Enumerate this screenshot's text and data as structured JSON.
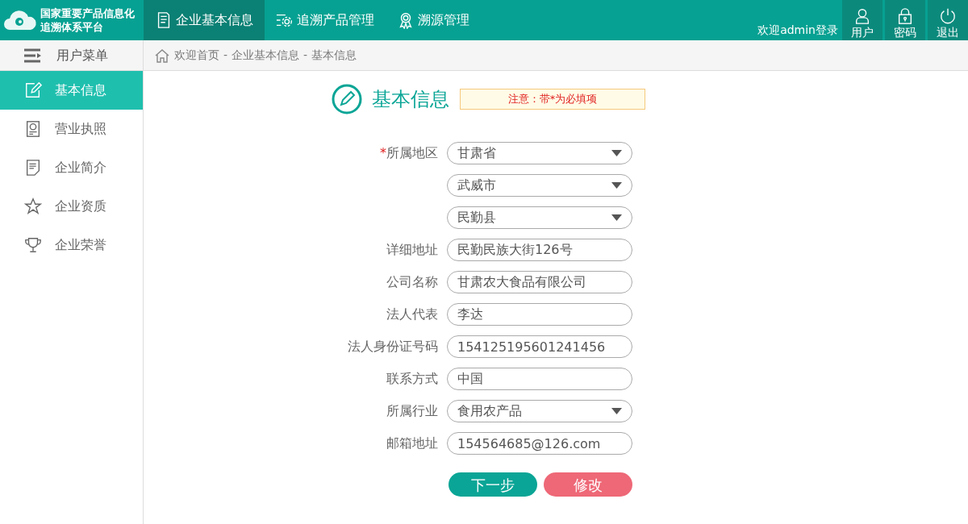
{
  "header": {
    "logo_text": [
      "国家重要产品信息化",
      "追溯体系平台"
    ],
    "nav": [
      {
        "label": "企业基本信息",
        "selected": true
      },
      {
        "label": "追溯产品管理",
        "selected": false
      },
      {
        "label": "溯源管理",
        "selected": false
      }
    ],
    "welcome": "欢迎admin登录",
    "actions": [
      {
        "label": "用户"
      },
      {
        "label": "密码"
      },
      {
        "label": "退出"
      }
    ]
  },
  "sidebar": {
    "title": "用户菜单",
    "items": [
      {
        "label": "基本信息",
        "selected": true
      },
      {
        "label": "营业执照",
        "selected": false
      },
      {
        "label": "企业简介",
        "selected": false
      },
      {
        "label": "企业资质",
        "selected": false
      },
      {
        "label": "企业荣誉",
        "selected": false
      }
    ]
  },
  "breadcrumb": {
    "separator": "-",
    "items": [
      "欢迎首页",
      "企业基本信息",
      "基本信息"
    ]
  },
  "form": {
    "title": "基本信息",
    "notice": "注意：带*为必填项",
    "required_mark": "*",
    "fields": [
      {
        "label": "所属地区",
        "kind": "select",
        "value": "甘肃省",
        "required": true
      },
      {
        "kind": "select",
        "value": "武威市",
        "required": false
      },
      {
        "kind": "select",
        "value": "民勤县",
        "required": false
      },
      {
        "label": "详细地址",
        "kind": "text",
        "value": "民勤民族大街126号",
        "required": false
      },
      {
        "label": "公司名称",
        "kind": "text",
        "value": "甘肃农大食品有限公司",
        "required": false
      },
      {
        "label": "法人代表",
        "kind": "text",
        "value": "李达",
        "required": false
      },
      {
        "label": "法人身份证号码",
        "kind": "text",
        "value": "154125195601241456",
        "required": false
      },
      {
        "label": "联系方式",
        "kind": "text",
        "value": "中国",
        "required": false
      },
      {
        "label": "所属行业",
        "kind": "select",
        "value": "食用农产品",
        "required": false
      },
      {
        "label": "邮箱地址",
        "kind": "text",
        "value": "154564685@126.com",
        "required": false
      }
    ],
    "buttons": [
      {
        "label": "下一步",
        "kind": "primary"
      },
      {
        "label": "修改",
        "kind": "danger"
      }
    ]
  }
}
